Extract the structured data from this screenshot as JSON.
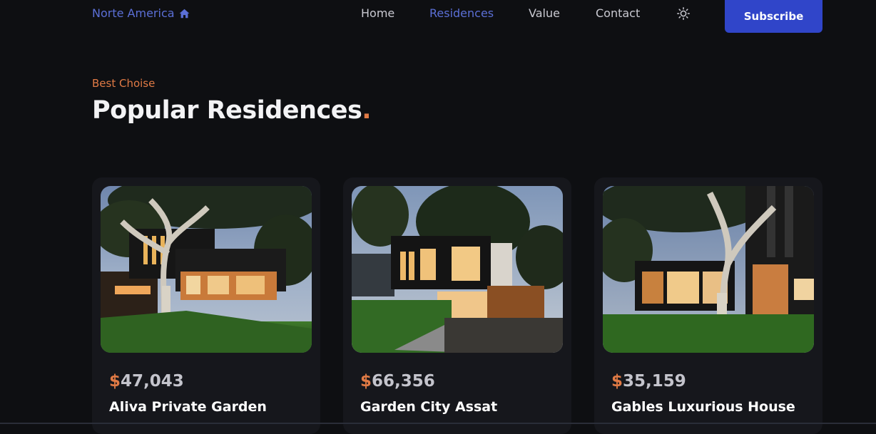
{
  "header": {
    "logo_text": "Norte America",
    "logo_icon": "home-icon",
    "nav": [
      {
        "label": "Home",
        "active": false
      },
      {
        "label": "Residences",
        "active": true
      },
      {
        "label": "Value",
        "active": false
      },
      {
        "label": "Contact",
        "active": false
      }
    ],
    "theme_icon": "sun-icon",
    "subscribe_label": "Subscribe"
  },
  "section": {
    "subtitle": "Best Choise",
    "title": "Popular Residences",
    "title_dot": "."
  },
  "cards": [
    {
      "currency": "$",
      "price": "47,043",
      "name": "Aliva Private Garden"
    },
    {
      "currency": "$",
      "price": "66,356",
      "name": "Garden City Assat"
    },
    {
      "currency": "$",
      "price": "35,159",
      "name": "Gables Luxurious House"
    }
  ],
  "colors": {
    "background": "#0e0f12",
    "card": "#16171c",
    "accent_blue": "#5b6fd6",
    "button_blue": "#3045c9",
    "accent_orange": "#e07a45"
  }
}
